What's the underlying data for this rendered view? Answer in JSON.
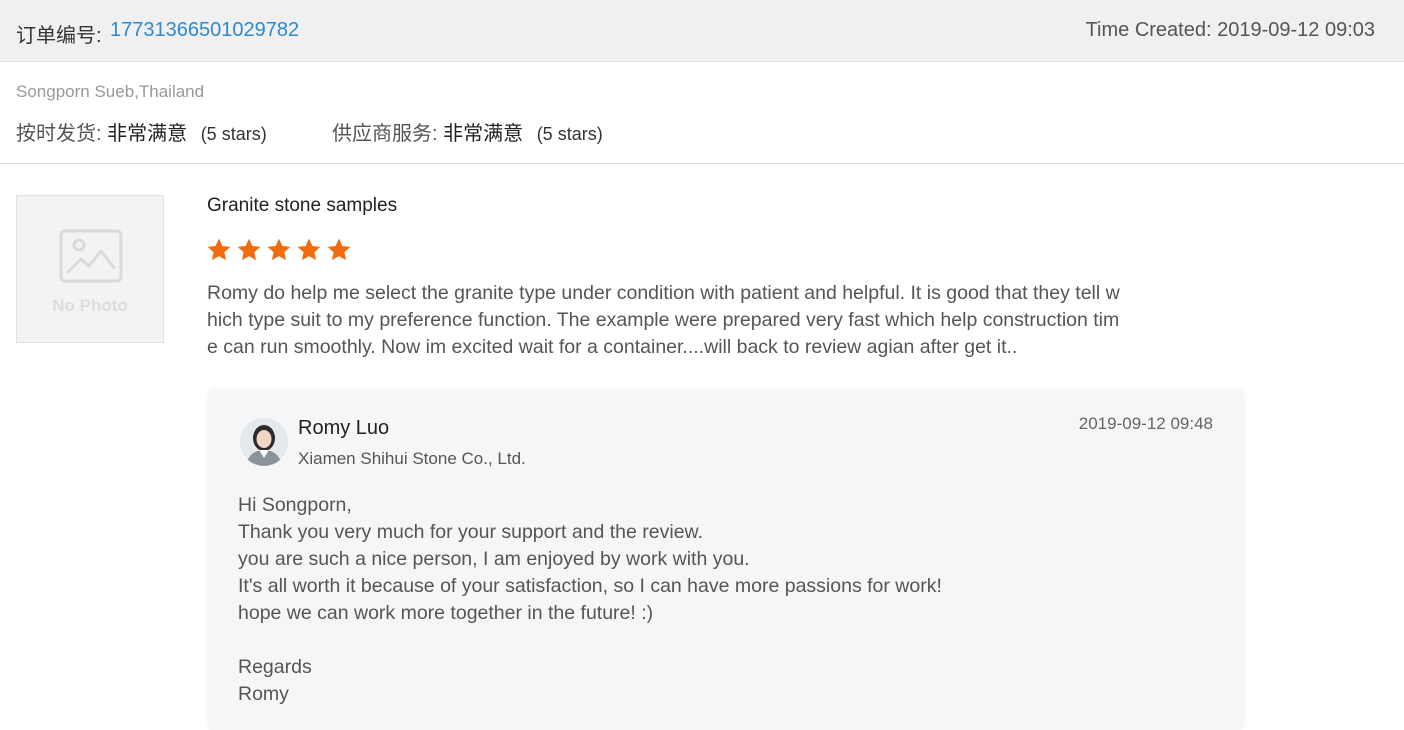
{
  "header": {
    "order_label": "订单编号:",
    "order_number": "17731366501029782",
    "time_created": "Time Created: 2019-09-12 09:03"
  },
  "buyer": {
    "name_location": "Songporn Sueb,Thailand"
  },
  "ratings": [
    {
      "label": "按时发货:",
      "value": "非常满意",
      "stars_text": "(5 stars)"
    },
    {
      "label": "供应商服务:",
      "value": "非常满意",
      "stars_text": "(5 stars)"
    }
  ],
  "product": {
    "photo_placeholder": "No Photo",
    "title": "Granite stone samples",
    "rating": 5,
    "star_color": "#f26b0f",
    "review_lines": [
      "Romy do help me select the granite type under condition with patient and helpful. It is good that they tell w",
      "hich type suit to my preference function. The example were prepared very fast which help construction tim",
      "e can run smoothly. Now im excited wait for a  container....will back to review agian after get it.."
    ]
  },
  "reply": {
    "name": "Romy Luo",
    "company": "Xiamen Shihui Stone Co., Ltd.",
    "time": "2019-09-12 09:48",
    "body_lines": [
      "Hi Songporn,",
      "Thank you very much for your support and the review.",
      "you are such a nice person, I am enjoyed by work with you.",
      "It's all worth it because of your satisfaction, so I can have more passions for work!",
      "hope we can work more together in the future! :)",
      "",
      "Regards",
      "Romy"
    ]
  },
  "colors": {
    "accent_link": "#2b8ad3",
    "header_bg": "#f0f0f0",
    "reply_bg": "#f5f6f7"
  }
}
